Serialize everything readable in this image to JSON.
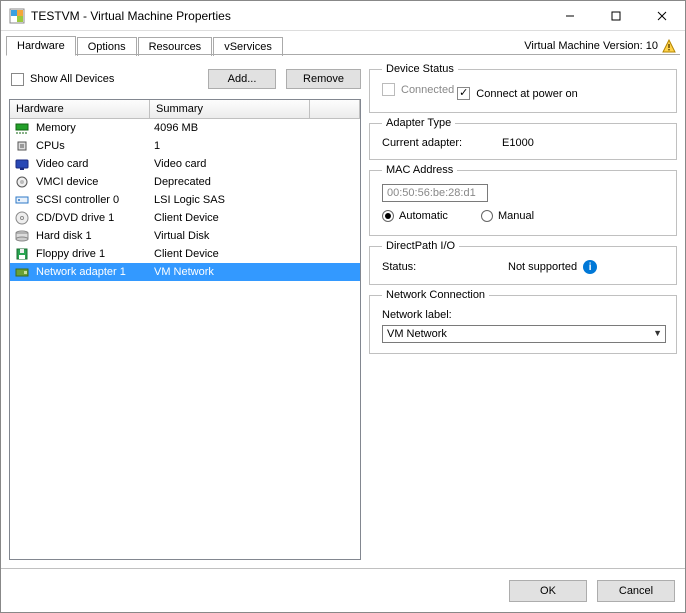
{
  "window": {
    "title": "TESTVM - Virtual Machine Properties"
  },
  "tabs": [
    {
      "label": "Hardware",
      "active": true
    },
    {
      "label": "Options",
      "active": false
    },
    {
      "label": "Resources",
      "active": false
    },
    {
      "label": "vServices",
      "active": false
    }
  ],
  "version_text": "Virtual Machine Version: 10",
  "left": {
    "show_all_label": "Show All Devices",
    "add_label": "Add...",
    "remove_label": "Remove",
    "col_hardware": "Hardware",
    "col_summary": "Summary",
    "rows": [
      {
        "icon": "memory-icon",
        "name": "Memory",
        "summary": "4096 MB",
        "color": "#23a02a"
      },
      {
        "icon": "cpu-icon",
        "name": "CPUs",
        "summary": "1",
        "color": "#555"
      },
      {
        "icon": "video-icon",
        "name": "Video card",
        "summary": "Video card",
        "color": "#2848b5"
      },
      {
        "icon": "vmci-icon",
        "name": "VMCI device",
        "summary": "Deprecated",
        "color": "#999"
      },
      {
        "icon": "scsi-icon",
        "name": "SCSI controller 0",
        "summary": "LSI Logic SAS",
        "color": "#2d78c7"
      },
      {
        "icon": "cddvd-icon",
        "name": "CD/DVD drive 1",
        "summary": "Client Device",
        "color": "#888"
      },
      {
        "icon": "disk-icon",
        "name": "Hard disk 1",
        "summary": "Virtual Disk",
        "color": "#8a8a8a"
      },
      {
        "icon": "floppy-icon",
        "name": "Floppy drive 1",
        "summary": "Client Device",
        "color": "#2aa552"
      },
      {
        "icon": "nic-icon",
        "name": "Network adapter 1",
        "summary": "VM Network",
        "color": "#6aa135",
        "selected": true
      }
    ]
  },
  "right": {
    "device_status": {
      "legend": "Device Status",
      "connected": "Connected",
      "connect_power": "Connect at power on"
    },
    "adapter_type": {
      "legend": "Adapter Type",
      "label": "Current adapter:",
      "value": "E1000"
    },
    "mac": {
      "legend": "MAC Address",
      "value": "00:50:56:be:28:d1",
      "auto": "Automatic",
      "manual": "Manual"
    },
    "directpath": {
      "legend": "DirectPath I/O",
      "label": "Status:",
      "value": "Not supported"
    },
    "netconn": {
      "legend": "Network Connection",
      "label": "Network label:",
      "value": "VM Network"
    }
  },
  "bottom": {
    "ok": "OK",
    "cancel": "Cancel"
  }
}
